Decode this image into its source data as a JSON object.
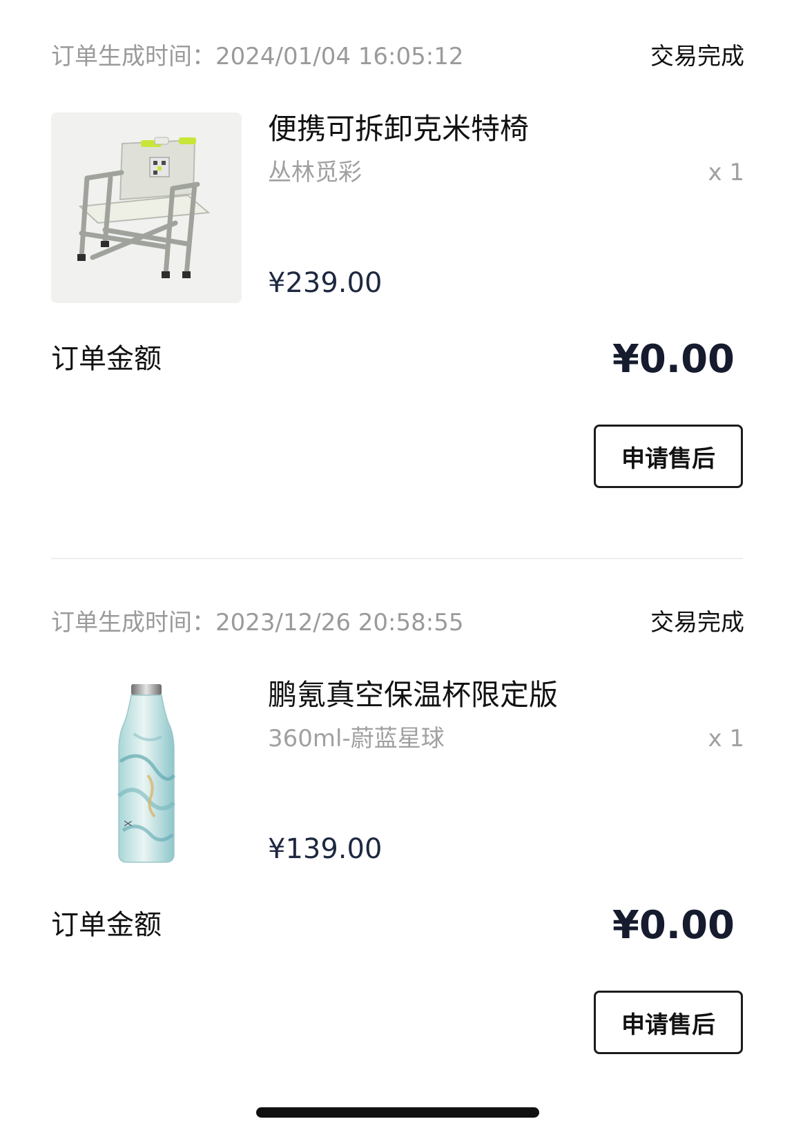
{
  "orders": [
    {
      "time_label": "订单生成时间：2024/01/04 16:05:12",
      "status": "交易完成",
      "product": {
        "name": "便携可拆卸克米特椅",
        "spec": "丛林觅彩",
        "quantity": "x 1",
        "price": "¥239.00",
        "image_icon": "folding-camp-chair-icon"
      },
      "amount_label": "订单金额",
      "amount_value": "¥0.00",
      "aftersale_label": "申请售后"
    },
    {
      "time_label": "订单生成时间：2023/12/26 20:58:55",
      "status": "交易完成",
      "product": {
        "name": "鹏氪真空保温杯限定版",
        "spec": "360ml-蔚蓝星球",
        "quantity": "x 1",
        "price": "¥139.00",
        "image_icon": "vacuum-bottle-icon"
      },
      "amount_label": "订单金额",
      "amount_value": "¥0.00",
      "aftersale_label": "申请售后"
    }
  ]
}
